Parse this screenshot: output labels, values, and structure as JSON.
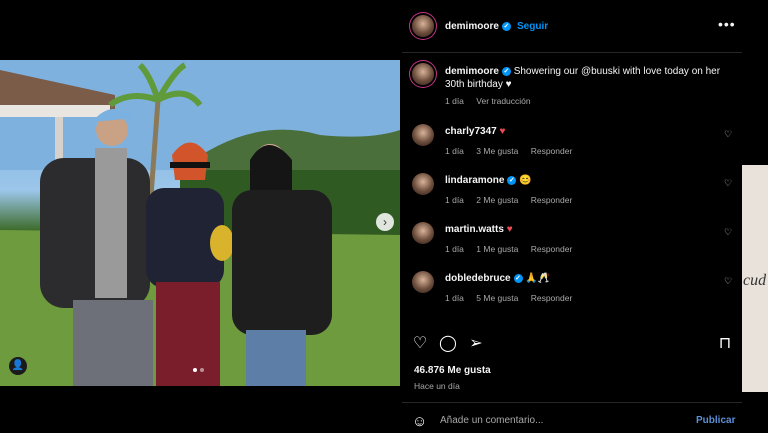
{
  "post": {
    "photo_alt": "",
    "carousel_arrow": "›"
  },
  "header": {
    "username": "demimoore",
    "follow_label": "Seguir",
    "more_label": "•••"
  },
  "caption": {
    "username": "demimoore",
    "text": "Showering our @buuski with love today on her 30th birthday ♥",
    "time": "1 día",
    "translate": "Ver traducción"
  },
  "comments": [
    {
      "user": "charly7347",
      "text": "♥",
      "time": "1 día",
      "likes": "3 Me gusta",
      "reply": "Responder",
      "verified": false
    },
    {
      "user": "lindaramone",
      "text": "😊",
      "time": "1 día",
      "likes": "2 Me gusta",
      "reply": "Responder",
      "verified": true
    },
    {
      "user": "martin.watts",
      "text": "♥",
      "time": "1 día",
      "likes": "1 Me gusta",
      "reply": "Responder",
      "verified": false
    },
    {
      "user": "dobledebruce",
      "text": "🙏🥂",
      "time": "1 día",
      "likes": "5 Me gusta",
      "reply": "Responder",
      "verified": true
    }
  ],
  "engagement": {
    "likes": "46.876 Me gusta",
    "ago": "Hace un día"
  },
  "composer": {
    "placeholder": "Añade un comentario...",
    "publish": "Publicar"
  },
  "icons": {
    "like": "heart-icon",
    "comment": "comment-icon",
    "share": "send-icon",
    "save": "bookmark-icon",
    "emoji": "smile-icon",
    "tag": "person-tag-icon"
  },
  "background_page": {
    "partial_text": "cud"
  },
  "colors": {
    "accent": "#0095f6",
    "like_red": "#ed4956"
  }
}
